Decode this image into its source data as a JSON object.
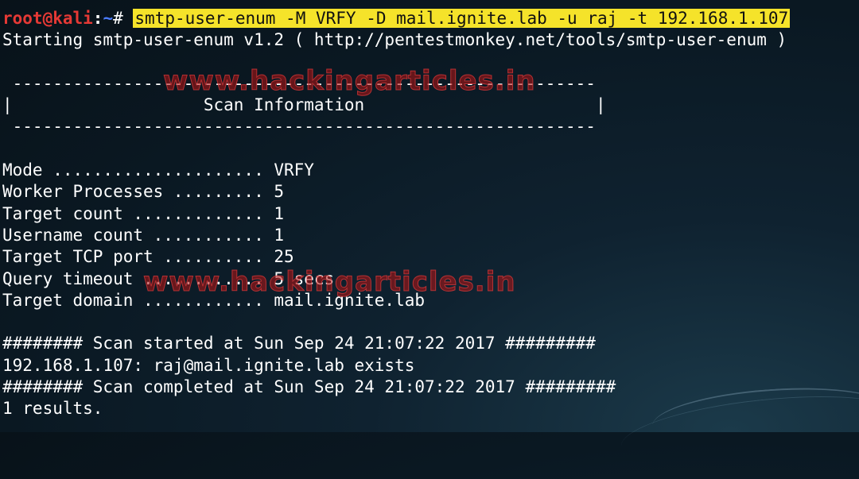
{
  "prompt": {
    "user": "root@kali",
    "separator": ":",
    "path": "~",
    "symbol": "# "
  },
  "command": "smtp-user-enum -M VRFY -D mail.ignite.lab -u raj -t 192.168.1.107",
  "output_lines": [
    "Starting smtp-user-enum v1.2 ( http://pentestmonkey.net/tools/smtp-user-enum )",
    "",
    " ----------------------------------------------------------",
    "|                   Scan Information                       |",
    " ----------------------------------------------------------",
    "",
    "Mode ..................... VRFY",
    "Worker Processes ......... 5",
    "Target count ............. 1",
    "Username count ........... 1",
    "Target TCP port .......... 25",
    "Query timeout ............ 5 secs",
    "Target domain ............ mail.ignite.lab",
    "",
    "######## Scan started at Sun Sep 24 21:07:22 2017 #########",
    "192.168.1.107: raj@mail.ignite.lab exists",
    "######## Scan completed at Sun Sep 24 21:07:22 2017 #########",
    "1 results."
  ],
  "watermark": "www.hackingarticles.in",
  "colors": {
    "prompt_user": "#e53935",
    "prompt_path": "#4a7cff",
    "command_highlight": "#f5e32a",
    "text": "#ffffff"
  }
}
